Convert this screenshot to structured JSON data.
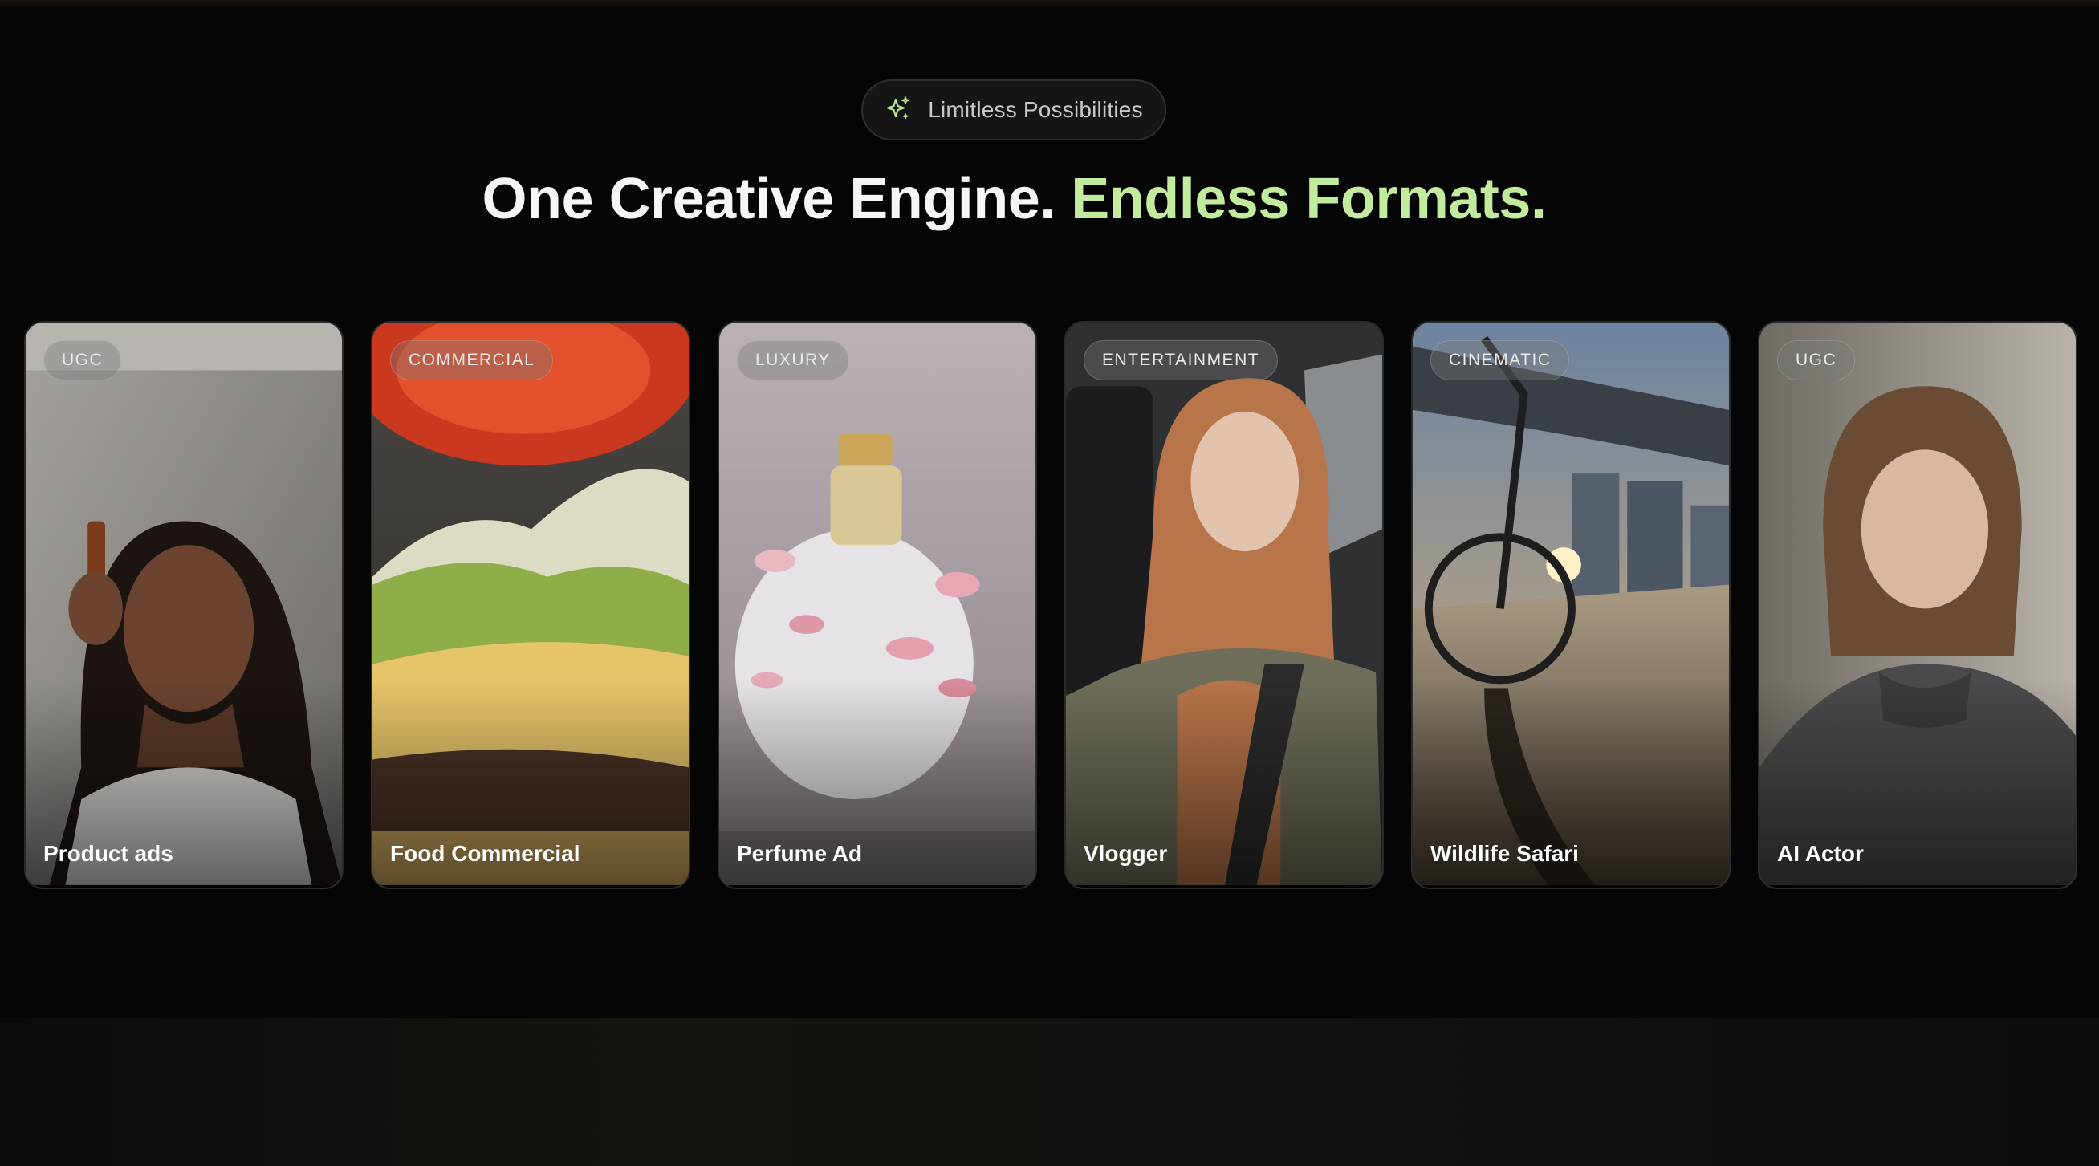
{
  "badge": {
    "icon": "sparkle-icon",
    "label": "Limitless Possibilities"
  },
  "headline": {
    "part1": "One Creative Engine.",
    "part2": "Endless Formats."
  },
  "colors": {
    "accent": "#c3eb9d",
    "background": "#050505"
  },
  "cards": [
    {
      "tag": "UGC",
      "title": "Product ads"
    },
    {
      "tag": "COMMERCIAL",
      "title": "Food Commercial"
    },
    {
      "tag": "LUXURY",
      "title": "Perfume Ad"
    },
    {
      "tag": "ENTERTAINMENT",
      "title": "Vlogger"
    },
    {
      "tag": "CINEMATIC",
      "title": "Wildlife Safari"
    },
    {
      "tag": "UGC",
      "title": "AI Actor"
    }
  ]
}
